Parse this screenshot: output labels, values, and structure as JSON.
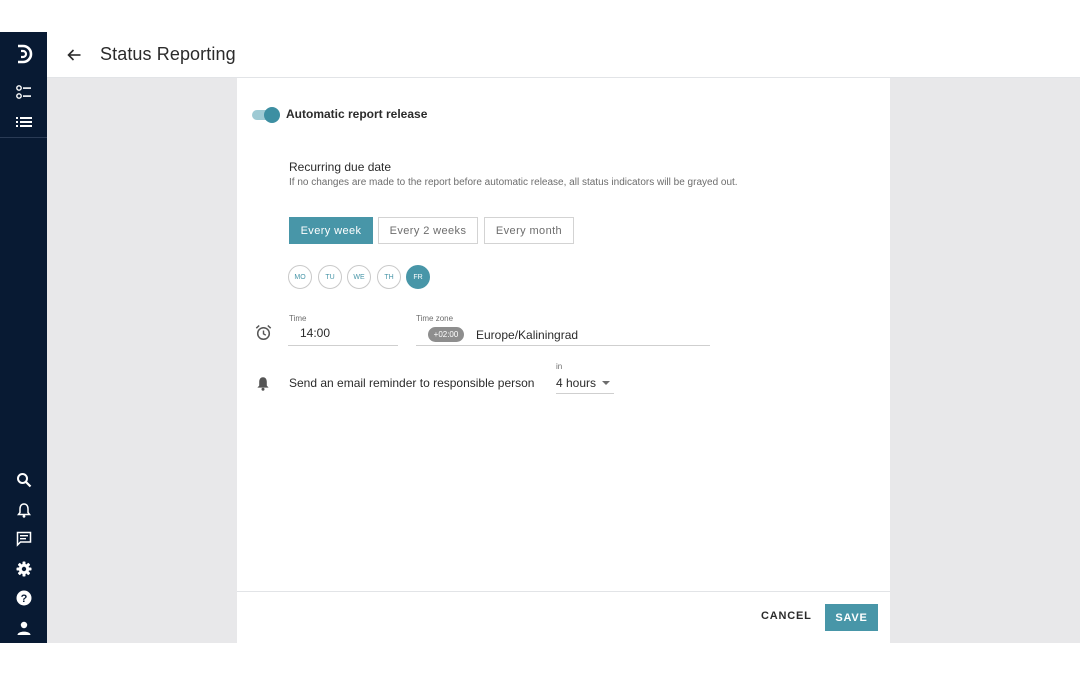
{
  "sidebar": {
    "top_icons": [
      "logo-icon",
      "checklist-icon",
      "list-icon"
    ],
    "bottom_icons": [
      "search-icon",
      "bell-icon",
      "comment-icon",
      "gear-icon",
      "help-icon",
      "user-icon"
    ]
  },
  "header": {
    "title": "Status Reporting",
    "back_icon": "arrow-left-icon"
  },
  "form": {
    "toggle_label": "Automatic report release",
    "toggle_on": true,
    "due_title": "Recurring due date",
    "due_description": "If no changes are made to the report before automatic release, all status indicators will be grayed out.",
    "frequency_options": [
      "Every week",
      "Every 2 weeks",
      "Every month"
    ],
    "frequency_selected": "Every week",
    "days": [
      "MO",
      "TU",
      "WE",
      "TH",
      "FR"
    ],
    "day_selected": "FR",
    "time_label": "Time",
    "time_value": "14:00",
    "timezone_label": "Time zone",
    "timezone_offset": "+02:00",
    "timezone_name": "Europe/Kaliningrad",
    "reminder_label": "Send an email reminder to responsible person",
    "reminder_in_label": "in",
    "reminder_value": "4 hours"
  },
  "footer": {
    "cancel": "CANCEL",
    "save": "SAVE"
  },
  "colors": {
    "accent": "#4896a8",
    "sidebar": "#081a33",
    "background": "#e8e8ea"
  }
}
